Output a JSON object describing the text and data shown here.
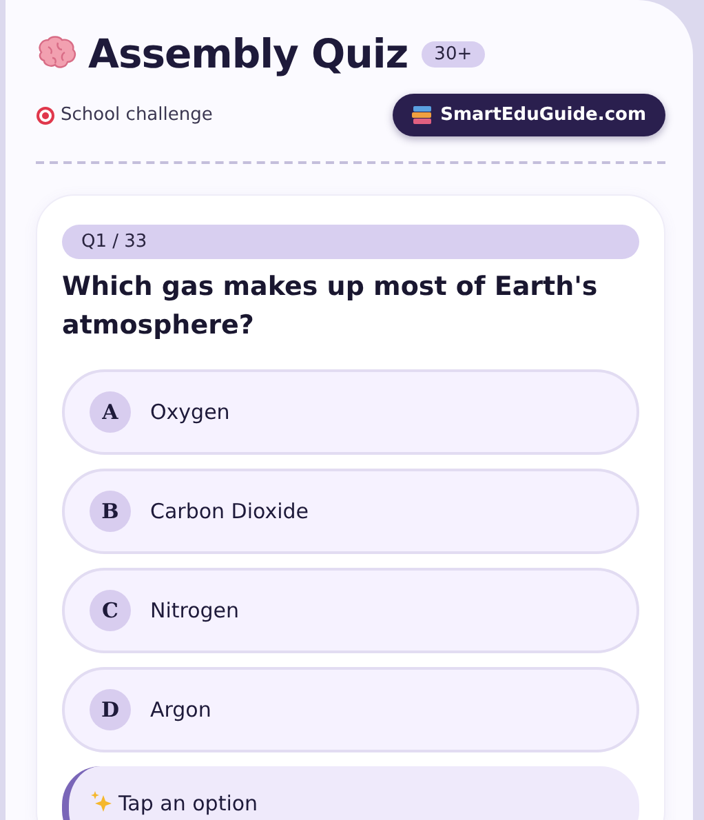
{
  "header": {
    "title": "Assembly Quiz",
    "badge": "30+",
    "subtitle": "School challenge",
    "site_button": "SmartEduGuide.com"
  },
  "question": {
    "progress": "Q1 / 33",
    "text": "Which gas makes up most of Earth's atmosphere?",
    "options": [
      {
        "letter": "A",
        "label": "Oxygen",
        "selected": false
      },
      {
        "letter": "B",
        "label": "Carbon Dioxide",
        "selected": false
      },
      {
        "letter": "C",
        "label": "Nitrogen",
        "selected": false
      },
      {
        "letter": "D",
        "label": "Argon",
        "selected": false
      }
    ],
    "hint": "Tap an option"
  }
}
